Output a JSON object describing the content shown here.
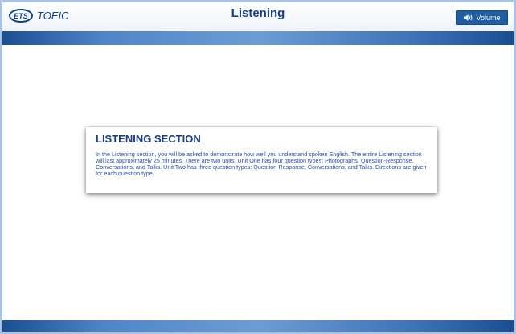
{
  "brand": {
    "ets": "ETS",
    "product": "TOEIC"
  },
  "header": {
    "title": "Listening",
    "volume_label": "Volume"
  },
  "section": {
    "title": "LISTENING SECTION",
    "description": "In the Listening section, you will be asked to demonstrate how well you understand spoken English. The entire Listening section will last approximately 25 minutes. There are two units. Unit One has four question types: Photographs, Question-Response, Conversations, and Talks. Unit Two has three question types: Question-Response, Conversations, and Talks. Directions are given for each question type."
  },
  "icons": {
    "volume": "speaker-icon"
  },
  "colors": {
    "accent": "#1f5da4",
    "title": "#143e8b",
    "text": "#2650a0"
  }
}
